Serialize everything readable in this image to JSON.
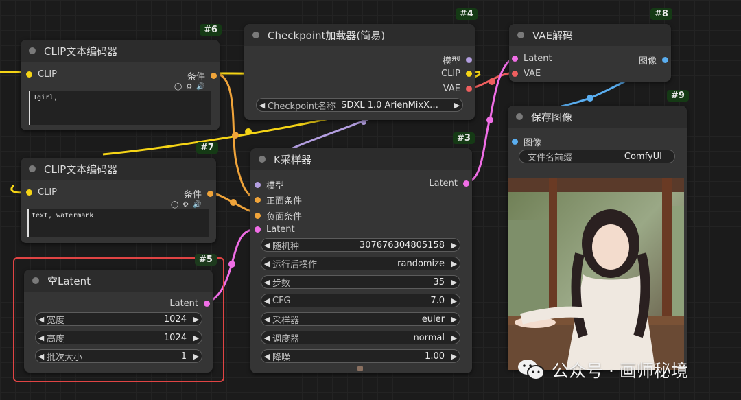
{
  "colors": {
    "clip": "#f5d416",
    "conditioning": "#f0a43a",
    "latent": "#f06ee6",
    "vae": "#ef5f5f",
    "model": "#b39ee0",
    "image": "#5aaef0",
    "badge_bg": "#153a15",
    "highlight": "#e04444"
  },
  "nodes": {
    "clip6": {
      "badge": "#6",
      "title": "CLIP文本编码器",
      "input_clip": "CLIP",
      "output_cond": "条件",
      "text": "1girl,"
    },
    "clip7": {
      "badge": "#7",
      "title": "CLIP文本编码器",
      "input_clip": "CLIP",
      "output_cond": "条件",
      "text": "text, watermark"
    },
    "checkpoint4": {
      "badge": "#4",
      "title": "Checkpoint加载器(简易)",
      "outputs": [
        "模型",
        "CLIP",
        "VAE"
      ],
      "widget_label": "Checkpoint名称",
      "widget_value": "SDXL 1.0 ArienMixX…"
    },
    "vae8": {
      "badge": "#8",
      "title": "VAE解码",
      "input_latent": "Latent",
      "input_vae": "VAE",
      "output_image": "图像"
    },
    "save9": {
      "badge": "#9",
      "title": "保存图像",
      "input_image": "图像",
      "widget_label": "文件名前缀",
      "widget_value": "ComfyUI"
    },
    "ksampler3": {
      "badge": "#3",
      "title": "K采样器",
      "inputs": [
        "模型",
        "正面条件",
        "负面条件",
        "Latent"
      ],
      "output_latent": "Latent",
      "widgets": [
        {
          "label": "随机种",
          "value": "307676304805158"
        },
        {
          "label": "运行后操作",
          "value": "randomize"
        },
        {
          "label": "步数",
          "value": "35"
        },
        {
          "label": "CFG",
          "value": "7.0"
        },
        {
          "label": "采样器",
          "value": "euler"
        },
        {
          "label": "调度器",
          "value": "normal"
        },
        {
          "label": "降噪",
          "value": "1.00"
        }
      ]
    },
    "latent5": {
      "badge": "#5",
      "title": "空Latent",
      "output_latent": "Latent",
      "widgets": [
        {
          "label": "宽度",
          "value": "1024"
        },
        {
          "label": "高度",
          "value": "1024"
        },
        {
          "label": "批次大小",
          "value": "1"
        }
      ]
    }
  },
  "watermark": {
    "text": "公众号 · 画师秘境",
    "icon": "wechat-icon"
  }
}
